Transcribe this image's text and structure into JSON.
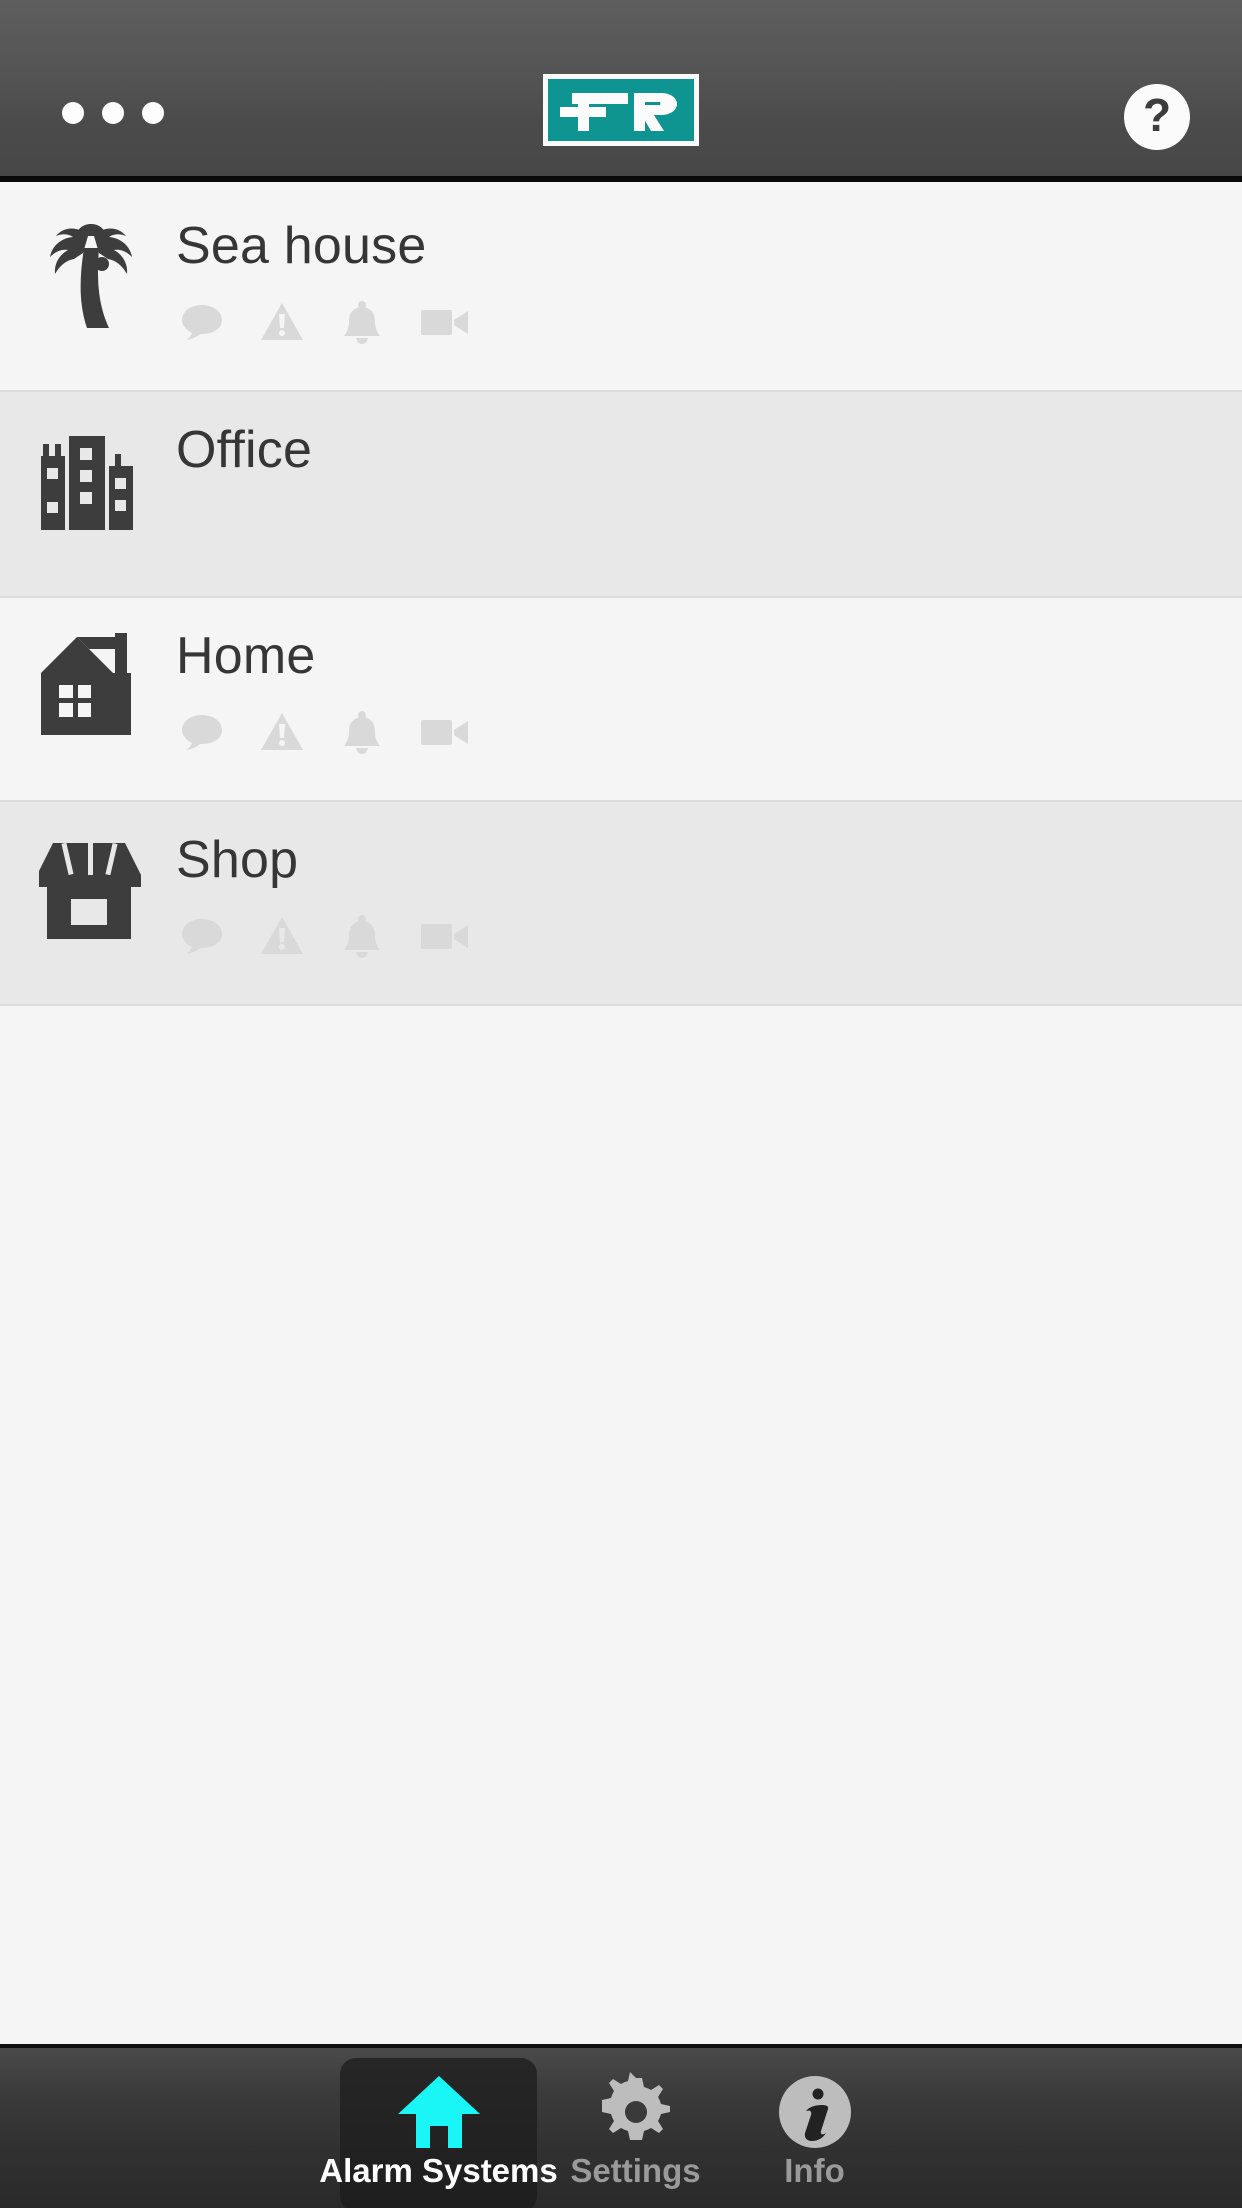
{
  "header": {
    "menu_icon": "overflow-menu-icon",
    "logo_text": "FR",
    "logo_bg_color": "#0e9591",
    "help_label": "?"
  },
  "list": {
    "items": [
      {
        "name": "Sea house",
        "icon": "palm-tree-icon",
        "shade": "light",
        "status_icons": [
          "message-icon",
          "warning-icon",
          "bell-icon",
          "video-camera-icon"
        ]
      },
      {
        "name": "Office",
        "icon": "office-buildings-icon",
        "shade": "dark",
        "status_icons": []
      },
      {
        "name": "Home",
        "icon": "house-icon",
        "shade": "light",
        "status_icons": [
          "message-icon",
          "warning-icon",
          "bell-icon",
          "video-camera-icon"
        ]
      },
      {
        "name": "Shop",
        "icon": "storefront-icon",
        "shade": "dark",
        "status_icons": [
          "message-icon",
          "warning-icon",
          "bell-icon",
          "video-camera-icon"
        ]
      }
    ]
  },
  "bottom_nav": {
    "active_index": 0,
    "accent_color": "#1af5f5",
    "tabs": [
      {
        "label": "Alarm Systems",
        "icon": "home-icon",
        "active": true
      },
      {
        "label": "Settings",
        "icon": "gear-icon",
        "active": false
      },
      {
        "label": "Info",
        "icon": "info-icon",
        "active": false
      }
    ]
  }
}
